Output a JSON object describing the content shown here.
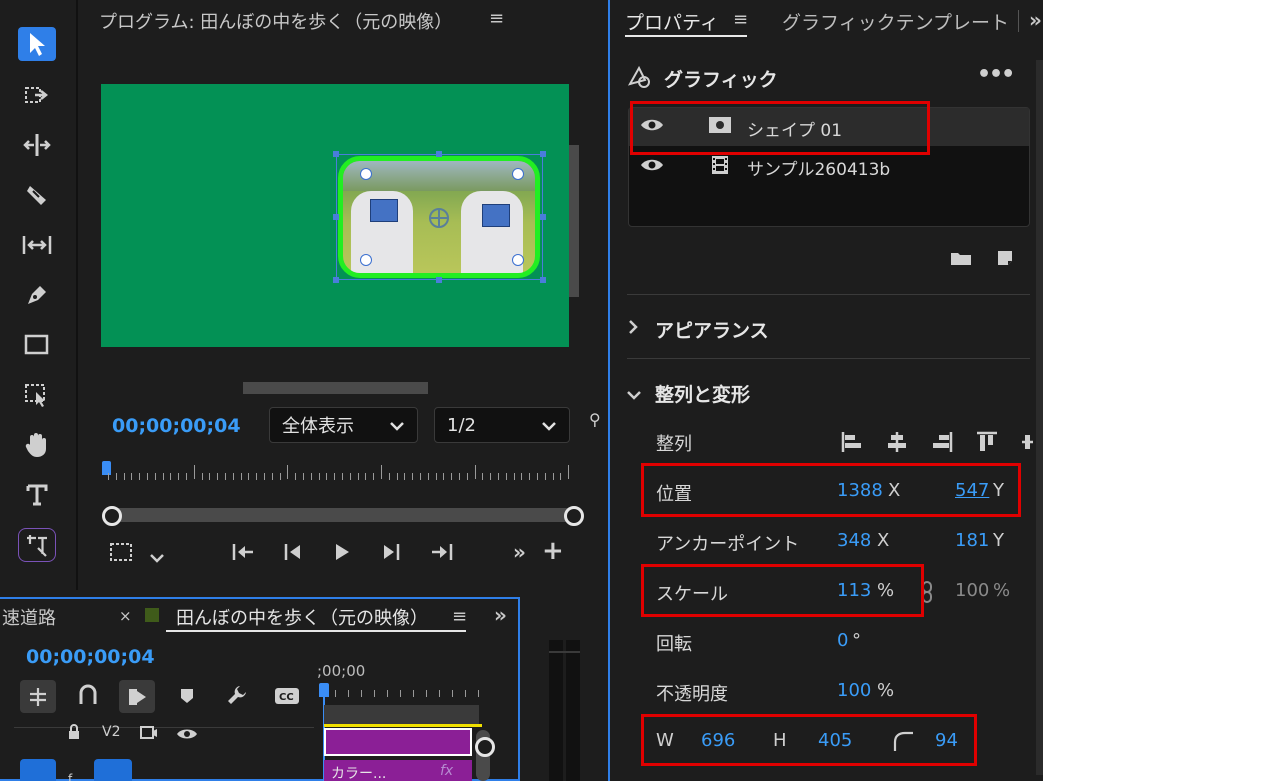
{
  "program_monitor": {
    "title": "プログラム: 田んぼの中を歩く（元の映像）",
    "timecode": "00;00;00;04",
    "zoom": "全体表示",
    "resolution": "1/2"
  },
  "properties_panel": {
    "tab_properties": "プロパティ",
    "tab_graphic_template": "グラフィックテンプレート",
    "section_graphic": "グラフィック",
    "layers": [
      {
        "name": "シェイプ 01",
        "type": "shape-icon"
      },
      {
        "name": "サンプル260413b",
        "type": "film-icon"
      }
    ],
    "appearance": "アピアランス",
    "align_transform": "整列と変形",
    "align_label": "整列",
    "position": {
      "label": "位置",
      "x": "1388",
      "x_unit": "X",
      "y": "547",
      "y_unit": "Y"
    },
    "anchor": {
      "label": "アンカーポイント",
      "x": "348",
      "x_unit": "X",
      "y": "181",
      "y_unit": "Y"
    },
    "scale": {
      "label": "スケール",
      "value": "113",
      "unit": "%",
      "value2": "100",
      "unit2": "%"
    },
    "rotation": {
      "label": "回転",
      "value": "0",
      "unit": "°"
    },
    "opacity": {
      "label": "不透明度",
      "value": "100",
      "unit": "%"
    },
    "size": {
      "w_label": "W",
      "w": "696",
      "h_label": "H",
      "h": "405",
      "radius": "94"
    }
  },
  "timeline": {
    "tab_prev": "速道路",
    "tab_active": "田んぼの中を歩く（元の映像）",
    "timecode": "00;00;00;04",
    "ruler_start": ";00;00",
    "track_v2": "V2",
    "clip_label": "カラー...",
    "fx_label": "fx"
  },
  "colors": {
    "accent": "#3a9cf7",
    "highlight_box": "#e00000",
    "green_screen": "#039155",
    "shape_border": "#22ee22",
    "clip_purple": "#8b1f96"
  }
}
